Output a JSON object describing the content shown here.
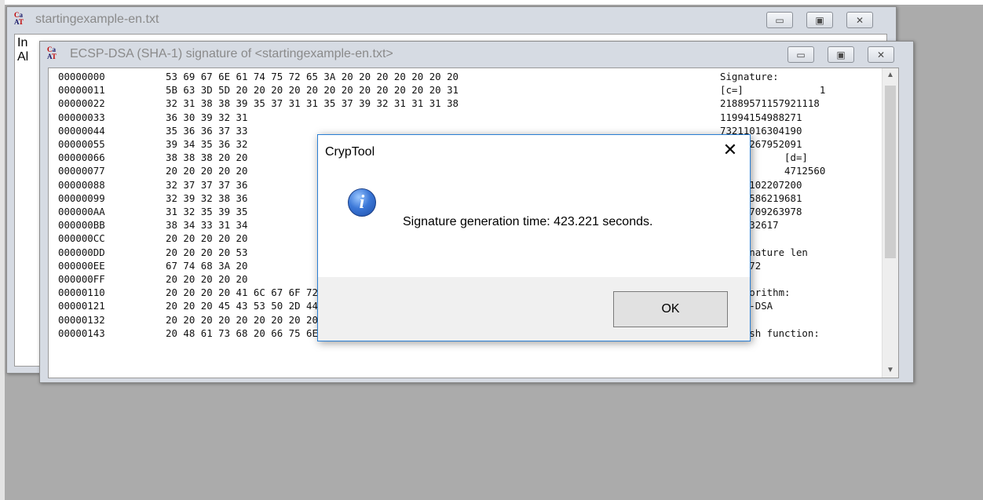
{
  "background_window": {
    "title": "startingexample-en.txt",
    "visible_text": [
      "In",
      "Al"
    ]
  },
  "signature_window": {
    "title": "ECSP-DSA (SHA-1) signature of <startingexample-en.txt>",
    "hex_rows": [
      {
        "offset": "00000000",
        "hex": "53 69 67 6E 61 74 75 72 65 3A 20 20 20 20 20 20 20",
        "ascii": "Signature:"
      },
      {
        "offset": "00000011",
        "hex": "5B 63 3D 5D 20 20 20 20 20 20 20 20 20 20 20 20 31",
        "ascii": "[c=]             1"
      },
      {
        "offset": "00000022",
        "hex": "32 31 38 38 39 35 37 31 31 35 37 39 32 31 31 31 38",
        "ascii": "21889571157921118"
      },
      {
        "offset": "00000033",
        "hex": "36 30 39 32 31",
        "ascii": "11994154988271"
      },
      {
        "offset": "00000044",
        "hex": "35 36 36 37 33",
        "ascii": "73211016304190"
      },
      {
        "offset": "00000055",
        "hex": "39 34 35 36 32",
        "ascii": "82615267952091"
      },
      {
        "offset": "00000066",
        "hex": "38 38 38 20 20",
        "ascii": "           [d=]"
      },
      {
        "offset": "00000077",
        "hex": "20 20 20 20 20",
        "ascii": "           4712560"
      },
      {
        "offset": "00000088",
        "hex": "32 37 37 37 36",
        "ascii": "76249102207200"
      },
      {
        "offset": "00000099",
        "hex": "32 39 32 38 36",
        "ascii": "86365586219681"
      },
      {
        "offset": "000000AA",
        "hex": "31 32 35 39 35",
        "ascii": "05064709263978"
      },
      {
        "offset": "000000BB",
        "hex": "38 34 33 31 34",
        "ascii": "1405532617"
      },
      {
        "offset": "000000CC",
        "hex": "20 20 20 20 20",
        "ascii": ""
      },
      {
        "offset": "000000DD",
        "hex": "20 20 20 20 53",
        "ascii": "  Signature len"
      },
      {
        "offset": "000000EE",
        "hex": "67 74 68 3A 20",
        "ascii": "    472"
      },
      {
        "offset": "000000FF",
        "hex": "20 20 20 20 20",
        "ascii": ""
      },
      {
        "offset": "00000110",
        "hex": "20 20 20 20 41 6C 67 6F 72 69 74 68 6D 3A 20 20 20",
        "ascii": "  Algorithm:"
      },
      {
        "offset": "00000121",
        "hex": "20 20 20 45 43 53 50 2D 44 53 41 20 20 20 20 20 20",
        "ascii": " ECSP-DSA"
      },
      {
        "offset": "00000132",
        "hex": "20 20 20 20 20 20 20 20 20 20 20 20 20 20 20 20 20",
        "ascii": ""
      },
      {
        "offset": "00000143",
        "hex": "20 48 61 73 68 20 66 75 6E 63 74 69 6F 6E 3A 20 20",
        "ascii": "   Hash function:"
      }
    ]
  },
  "dialog": {
    "title": "CrypTool",
    "message": "Signature generation time: 423.221 seconds.",
    "ok_label": "OK",
    "close_glyph": "✕"
  },
  "window_buttons": {
    "minimize": "▭",
    "maximize": "▣",
    "close": "✕"
  },
  "icons": {
    "app": "cryptool-app-icon",
    "info": "info-icon"
  }
}
